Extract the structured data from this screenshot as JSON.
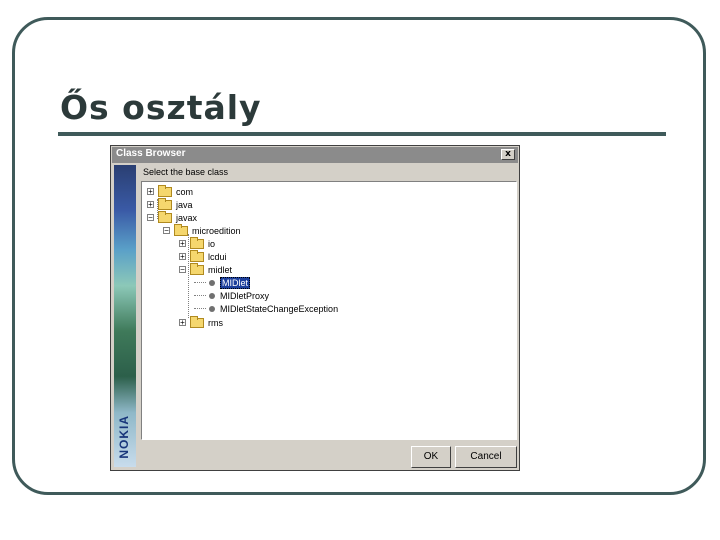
{
  "slide": {
    "title": "Ős osztály"
  },
  "dialog": {
    "title": "Class Browser",
    "close_label": "x",
    "prompt": "Select the base class",
    "brand": "NOKIA",
    "ok_label": "OK",
    "cancel_label": "Cancel"
  },
  "tree": {
    "com": "com",
    "java": "java",
    "javax": "javax",
    "microedition": "microedition",
    "io": "io",
    "lcdui": "lcdui",
    "midlet": "midlet",
    "midlet_class": "MIDlet",
    "midletproxy_class": "MIDletProxy",
    "midletstate_class": "MIDletStateChangeException",
    "rms": "rms"
  }
}
